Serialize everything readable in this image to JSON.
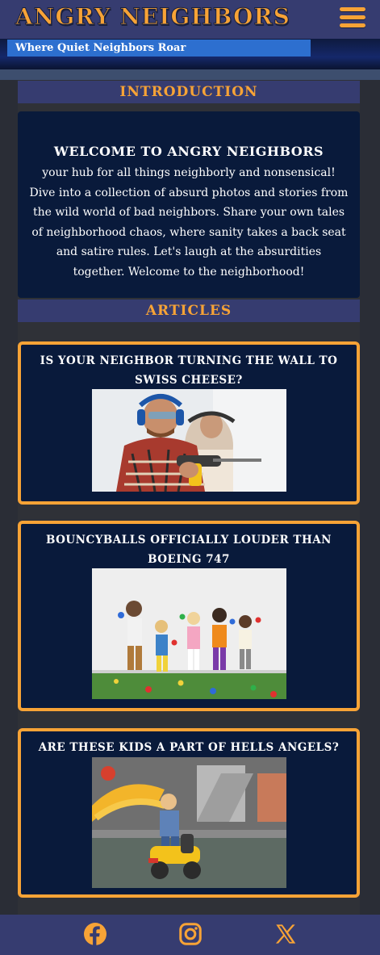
{
  "header": {
    "title": "ANGRY NEIGHBORS",
    "tagline": "Where Quiet Neighbors Roar",
    "menu_icon": "hamburger-menu-icon"
  },
  "intro": {
    "section_title": "INTRODUCTION",
    "heading": "WELCOME TO ANGRY NEIGHBORS",
    "body": "your hub for all things neighborly and nonsensical! Dive into a collection of absurd photos and stories from the wild world of bad neighbors. Share your own tales of neighborhood chaos, where sanity takes a back seat and satire rules. Let's laugh at the absurdities together. Welcome to the neighborhood!"
  },
  "articles": {
    "section_title": "ARTICLES",
    "items": [
      {
        "title": "IS YOUR NEIGHBOR TURNING THE WALL TO SWISS CHEESE?"
      },
      {
        "title": "BOUNCYBALLS OFFICIALLY LOUDER THAN BOEING 747"
      },
      {
        "title": "ARE THESE KIDS A PART OF HELLS ANGELS?"
      }
    ]
  },
  "footer": {
    "icons": [
      "facebook-icon",
      "instagram-icon",
      "x-icon"
    ]
  },
  "colors": {
    "accent": "#f7a336",
    "header_bg": "#363c70",
    "panel_bg": "#091a3b",
    "tagline_bg": "#2d6fcf"
  }
}
